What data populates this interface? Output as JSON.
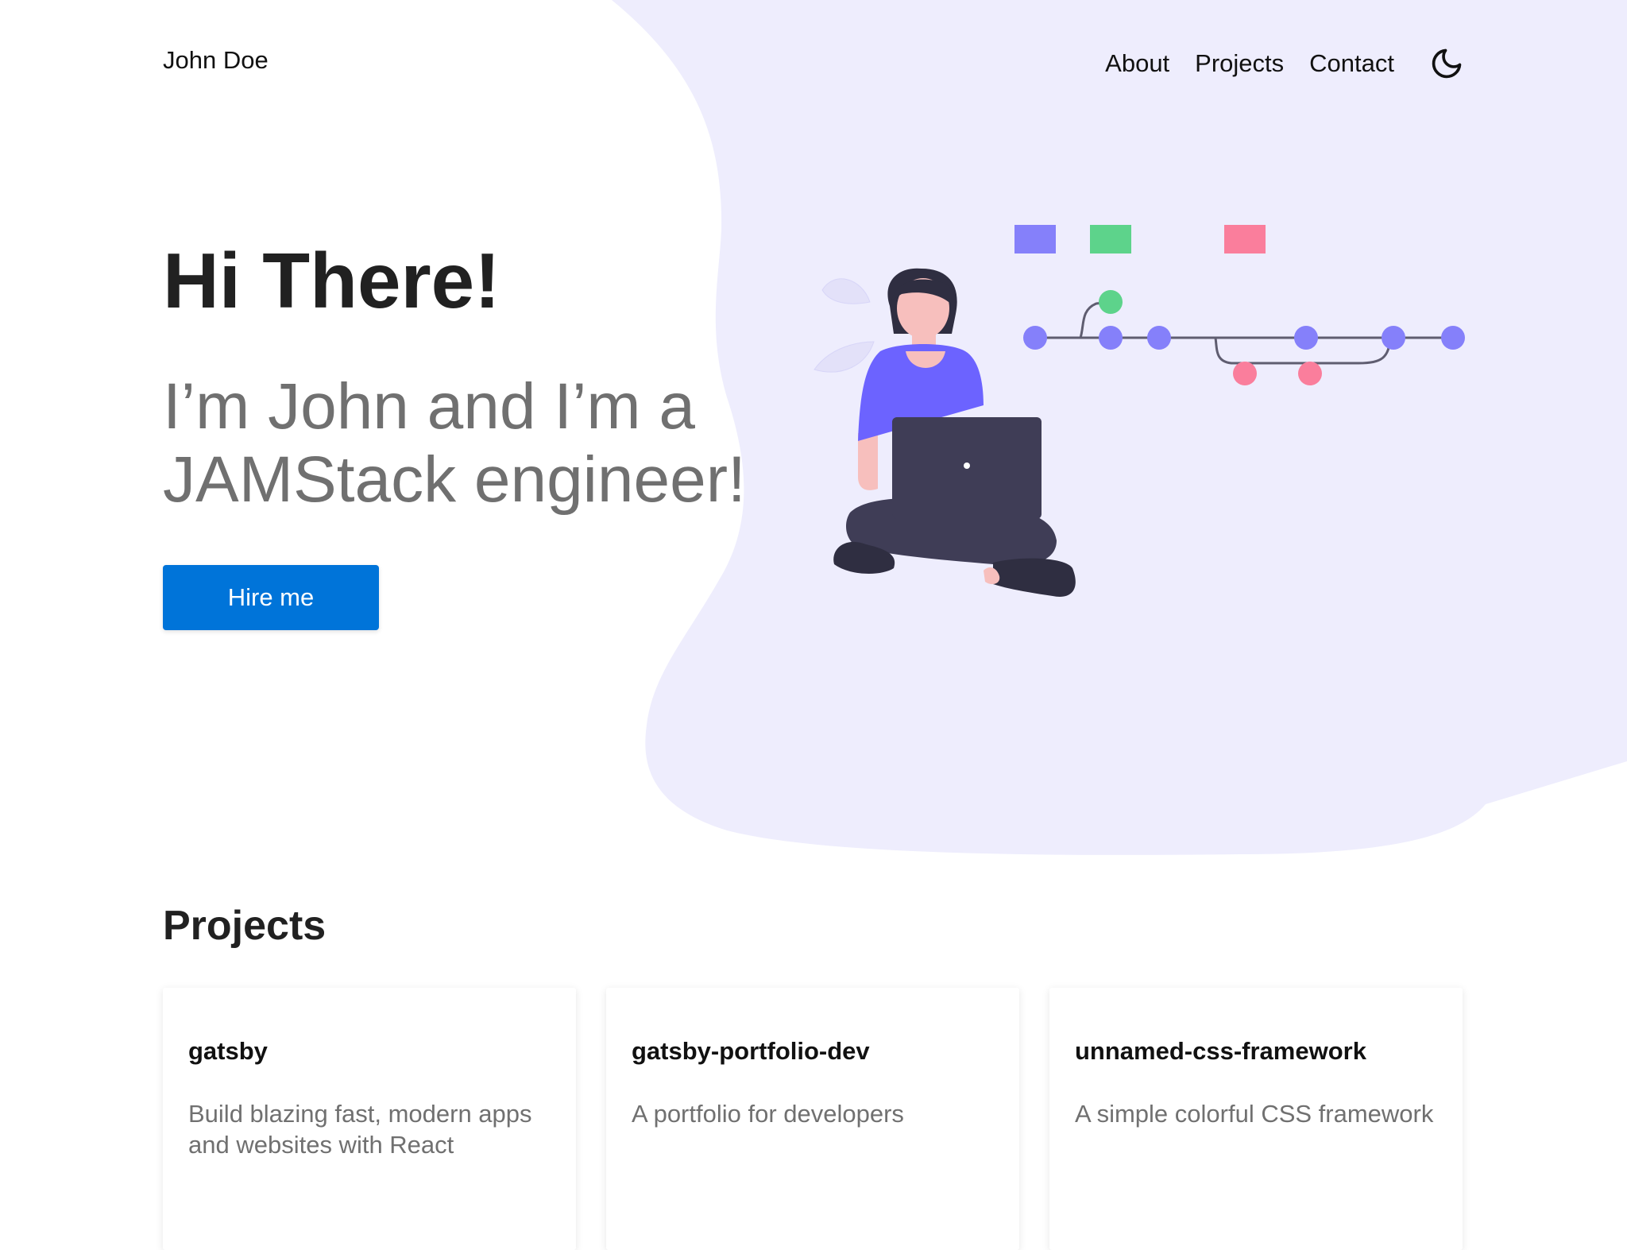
{
  "header": {
    "brand": "John Doe",
    "nav": [
      "About",
      "Projects",
      "Contact"
    ],
    "theme_toggle_icon": "moon-icon"
  },
  "hero": {
    "title": "Hi There!",
    "subtitle_line1": "I’m John and I’m a",
    "subtitle_line2": "JAMStack engineer!",
    "cta": "Hire me"
  },
  "projects": {
    "title": "Projects",
    "items": [
      {
        "name": "gatsby",
        "description": "Build blazing fast, modern apps and websites with React"
      },
      {
        "name": "gatsby-portfolio-dev",
        "description": "A portfolio for developers"
      },
      {
        "name": "unnamed-css-framework",
        "description": "A simple colorful CSS framework"
      }
    ]
  },
  "colors": {
    "accent": "#0074d9",
    "blob": "#eeedfd",
    "purple": "#8580fa",
    "green": "#5dd38b",
    "pink": "#fa7e9c",
    "dark": "#3f3d56"
  }
}
